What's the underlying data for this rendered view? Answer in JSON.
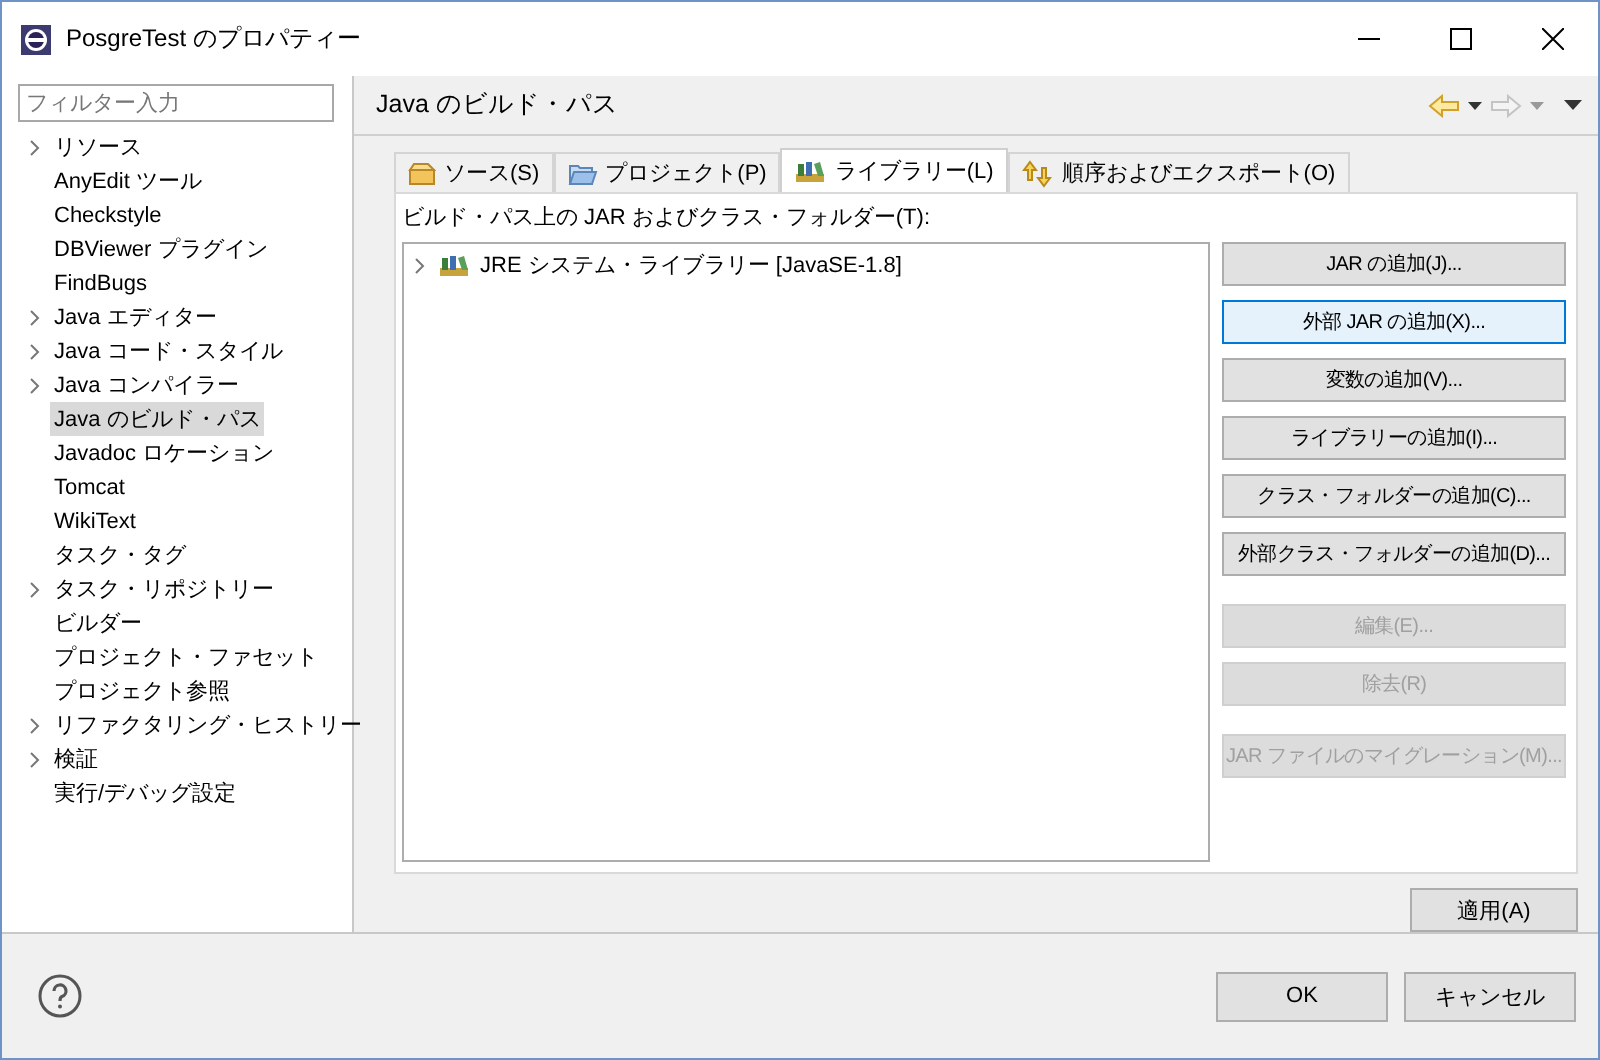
{
  "window": {
    "title": "PosgreTest のプロパティー"
  },
  "sidebar": {
    "filter": {
      "placeholder": "フィルター入力"
    },
    "items": [
      {
        "label": "リソース",
        "expandable": true,
        "selected": false
      },
      {
        "label": "AnyEdit ツール",
        "expandable": false,
        "selected": false
      },
      {
        "label": "Checkstyle",
        "expandable": false,
        "selected": false
      },
      {
        "label": "DBViewer プラグイン",
        "expandable": false,
        "selected": false
      },
      {
        "label": "FindBugs",
        "expandable": false,
        "selected": false
      },
      {
        "label": "Java エディター",
        "expandable": true,
        "selected": false
      },
      {
        "label": "Java コード・スタイル",
        "expandable": true,
        "selected": false
      },
      {
        "label": "Java コンパイラー",
        "expandable": true,
        "selected": false
      },
      {
        "label": "Java のビルド・パス",
        "expandable": false,
        "selected": true
      },
      {
        "label": "Javadoc ロケーション",
        "expandable": false,
        "selected": false
      },
      {
        "label": "Tomcat",
        "expandable": false,
        "selected": false
      },
      {
        "label": "WikiText",
        "expandable": false,
        "selected": false
      },
      {
        "label": "タスク・タグ",
        "expandable": false,
        "selected": false
      },
      {
        "label": "タスク・リポジトリー",
        "expandable": true,
        "selected": false
      },
      {
        "label": "ビルダー",
        "expandable": false,
        "selected": false
      },
      {
        "label": "プロジェクト・ファセット",
        "expandable": false,
        "selected": false
      },
      {
        "label": "プロジェクト参照",
        "expandable": false,
        "selected": false
      },
      {
        "label": "リファクタリング・ヒストリー",
        "expandable": true,
        "selected": false
      },
      {
        "label": "検証",
        "expandable": true,
        "selected": false
      },
      {
        "label": "実行/デバッグ設定",
        "expandable": false,
        "selected": false
      }
    ]
  },
  "page": {
    "title": "Java のビルド・パス",
    "tabs": [
      {
        "label": "ソース(S)",
        "kind": "source",
        "selected": false
      },
      {
        "label": "プロジェクト(P)",
        "kind": "project",
        "selected": false
      },
      {
        "label": "ライブラリー(L)",
        "kind": "library",
        "selected": true
      },
      {
        "label": "順序およびエクスポート(O)",
        "kind": "order",
        "selected": false
      }
    ],
    "list_label": "ビルド・パス上の JAR およびクラス・フォルダー(T):",
    "tree": [
      {
        "label": "JRE システム・ライブラリー [JavaSE-1.8]",
        "expanded": false
      }
    ],
    "button_groups": [
      [
        {
          "label": "JAR の追加(J)...",
          "disabled": false,
          "focused": false
        },
        {
          "label": "外部 JAR の追加(X)...",
          "disabled": false,
          "focused": true
        },
        {
          "label": "変数の追加(V)...",
          "disabled": false,
          "focused": false
        },
        {
          "label": "ライブラリーの追加(I)...",
          "disabled": false,
          "focused": false
        },
        {
          "label": "クラス・フォルダーの追加(C)...",
          "disabled": false,
          "focused": false
        },
        {
          "label": "外部クラス・フォルダーの追加(D)...",
          "disabled": false,
          "focused": false
        }
      ],
      [
        {
          "label": "編集(E)...",
          "disabled": true,
          "focused": false
        },
        {
          "label": "除去(R)",
          "disabled": true,
          "focused": false
        }
      ],
      [
        {
          "label": "JAR ファイルのマイグレーション(M)...",
          "disabled": true,
          "focused": false
        }
      ]
    ],
    "apply": "適用(A)"
  },
  "footer": {
    "buttons": [
      "OK",
      "キャンセル"
    ]
  }
}
